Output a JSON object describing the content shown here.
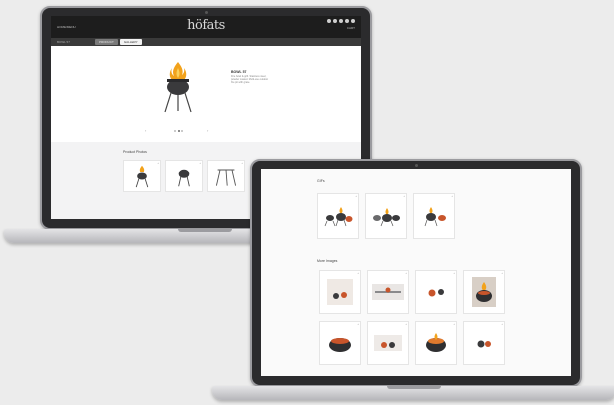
{
  "product_site": {
    "brand": "höfats",
    "nav_left": "HOME/MENU",
    "nav_right": "CART",
    "subbar_label": "BOWL 57",
    "subtabs": [
      {
        "label": "PRODUCT",
        "active": false
      },
      {
        "label": "GALLERY",
        "active": true
      }
    ],
    "product_title": "BOWL 57",
    "product_description": "Fire bowl & grill. Stainless steel, powder coated. Multi-use outdoor fire pit with grate.",
    "carousel": {
      "prev": "‹",
      "next": "›",
      "slides": 3,
      "current": 2
    },
    "photos_section": {
      "title": "Product Photos",
      "items": [
        {
          "icon": "grill-with-flame-icon",
          "corner": "+"
        },
        {
          "icon": "grill-bowl-icon",
          "corner": "+"
        },
        {
          "icon": "tripod-stand-icon",
          "corner": "+"
        }
      ]
    }
  },
  "gallery_site": {
    "gifs_section": {
      "title": "GIFs",
      "items": [
        {
          "icon": "grill-group-icon",
          "corner": "+"
        },
        {
          "icon": "grill-group-icon",
          "corner": "+"
        },
        {
          "icon": "grill-group-icon",
          "corner": "+"
        }
      ]
    },
    "more_section": {
      "title": "More Images",
      "row1": [
        {
          "icon": "two-balls-icon",
          "corner": "+"
        },
        {
          "icon": "long-table-icon",
          "corner": "+"
        },
        {
          "icon": "two-balls-icon",
          "corner": "+"
        },
        {
          "icon": "fire-bowl-icon",
          "corner": "+"
        }
      ],
      "row2": [
        {
          "icon": "fire-bowl-icon",
          "corner": "+"
        },
        {
          "icon": "two-balls-icon",
          "corner": "+"
        },
        {
          "icon": "fire-bowl-icon",
          "corner": "+"
        },
        {
          "icon": "two-balls-icon",
          "corner": "+"
        }
      ]
    }
  },
  "colors": {
    "header_dark": "#1d1d1d",
    "flame": "#f2a21b",
    "bowl": "#3a3a3c",
    "ember": "#c8552b"
  }
}
